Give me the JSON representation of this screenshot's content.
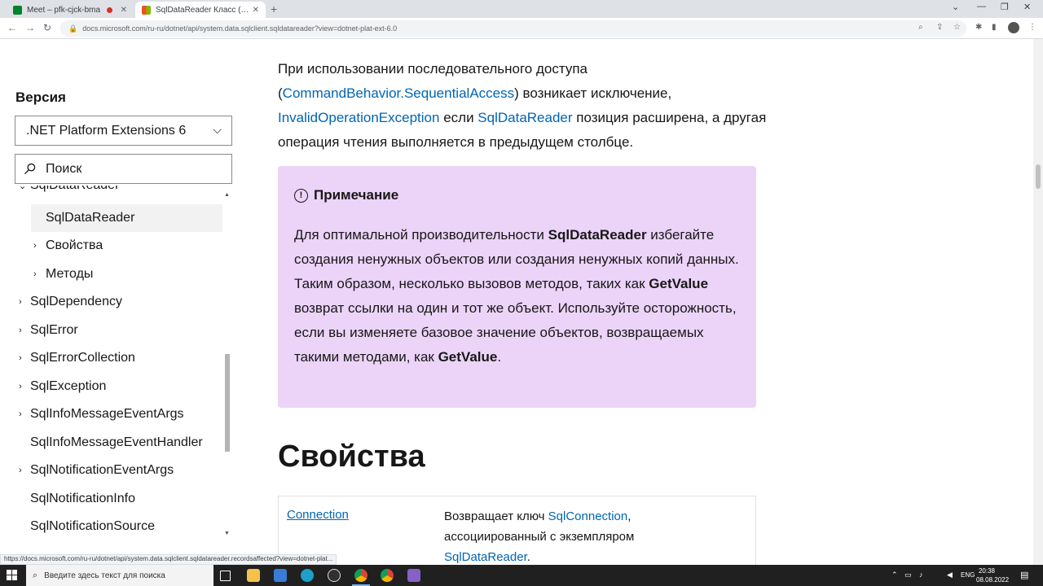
{
  "browser": {
    "tabs": [
      {
        "title": "Meet – pfk-cjck-bma"
      },
      {
        "title": "SqlDataReader Класс (System.Data.SqlClient)"
      }
    ],
    "url": "docs.microsoft.com/ru-ru/dotnet/api/system.data.sqlclient.sqldatareader?view=dotnet-plat-ext-6.0",
    "status_url": "https://docs.microsoft.com/ru-ru/dotnet/api/system.data.sqlclient.sqldatareader.recordsaffected?view=dotnet-plat..."
  },
  "sidebar": {
    "version_label": "Версия",
    "version_value": ".NET Platform Extensions 6",
    "search_placeholder": "Поиск",
    "toc": [
      {
        "label": "SqlDataReader",
        "expanded": true
      },
      {
        "label": "SqlDataReader",
        "selected": true
      },
      {
        "label": "Свойства"
      },
      {
        "label": "Методы"
      },
      {
        "label": "SqlDependency"
      },
      {
        "label": "SqlError"
      },
      {
        "label": "SqlErrorCollection"
      },
      {
        "label": "SqlException"
      },
      {
        "label": "SqlInfoMessageEventArgs"
      },
      {
        "label": "SqlInfoMessageEventHandler"
      },
      {
        "label": "SqlNotificationEventArgs"
      },
      {
        "label": "SqlNotificationInfo"
      },
      {
        "label": "SqlNotificationSource"
      }
    ]
  },
  "content": {
    "para": {
      "t1": "При использовании последовательного доступа (",
      "link1": "CommandBehavior.SequentialAccess",
      "t2": ") возникает исключение, ",
      "link2": "InvalidOperationException",
      "t3": " если ",
      "link3": "SqlDataReader",
      "t4": " позиция расширена, а другая операция чтения выполняется в предыдущем столбце."
    },
    "note": {
      "title": "Примечание",
      "t1": "Для оптимальной производительности ",
      "b1": "SqlDataReader",
      "t2": " избегайте создания ненужных объектов или создания ненужных копий данных. Таким образом, несколько вызовов методов, таких как ",
      "b2": "GetValue",
      "t3": " возврат ссылки на один и тот же объект. Используйте осторожность, если вы изменяете базовое значение объектов, возвращаемых такими методами, как ",
      "b3": "GetValue",
      "t4": "."
    },
    "properties_heading": "Свойства",
    "properties_table": [
      {
        "name": "Connection",
        "desc_t1": "Возвращает ключ ",
        "desc_link1": "SqlConnection",
        "desc_t2": ", ассоциированный с экземпляром ",
        "desc_link2": "SqlDataReader",
        "desc_t3": "."
      }
    ]
  },
  "taskbar": {
    "search_placeholder": "Введите здесь текст для поиска",
    "lang": "ENG",
    "time": "20:38",
    "date": "08.08.2022"
  },
  "colors": {
    "link": "#0065b3",
    "note_bg": "#ecd3f8"
  }
}
